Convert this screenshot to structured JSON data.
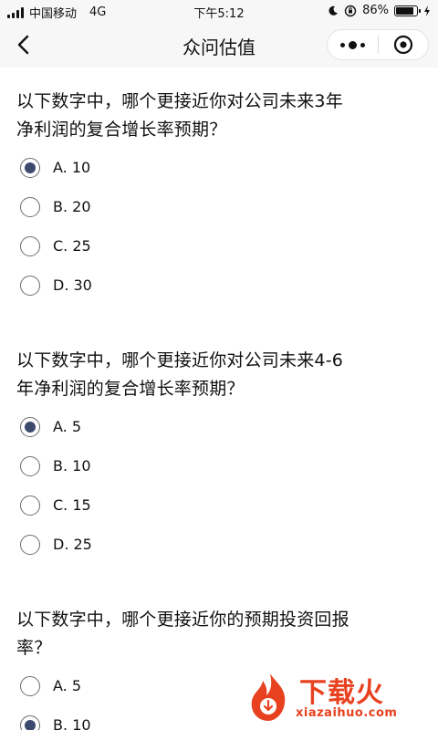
{
  "status_bar": {
    "carrier": "中国移动",
    "network": "4G",
    "time": "下午5:12",
    "battery": "86%",
    "battery_level": 0.86
  },
  "nav": {
    "title": "众问估值"
  },
  "questions": [
    {
      "title_lines": [
        "以下数字中，哪个更接近你对公司未来3年",
        "净利润的复合增长率预期？"
      ],
      "options": [
        "A. 10",
        "B. 20",
        "C. 25",
        "D. 30"
      ],
      "selected": 0
    },
    {
      "title_lines": [
        "以下数字中，哪个更接近你对公司未来4-6",
        "年净利润的复合增长率预期？"
      ],
      "options": [
        "A. 5",
        "B. 10",
        "C. 15",
        "D. 25"
      ],
      "selected": 0
    },
    {
      "title_lines": [
        "以下数字中，哪个更接近你的预期投资回报",
        "率？"
      ],
      "options": [
        "A. 5",
        "B. 10"
      ],
      "selected": 1
    }
  ],
  "watermark": {
    "text": "下载火",
    "url": "xiazaihuo.com"
  },
  "colors": {
    "radio_selected": "#3c4a6e",
    "watermark": "#e8411f",
    "bar_background": "#f7f7f7"
  }
}
